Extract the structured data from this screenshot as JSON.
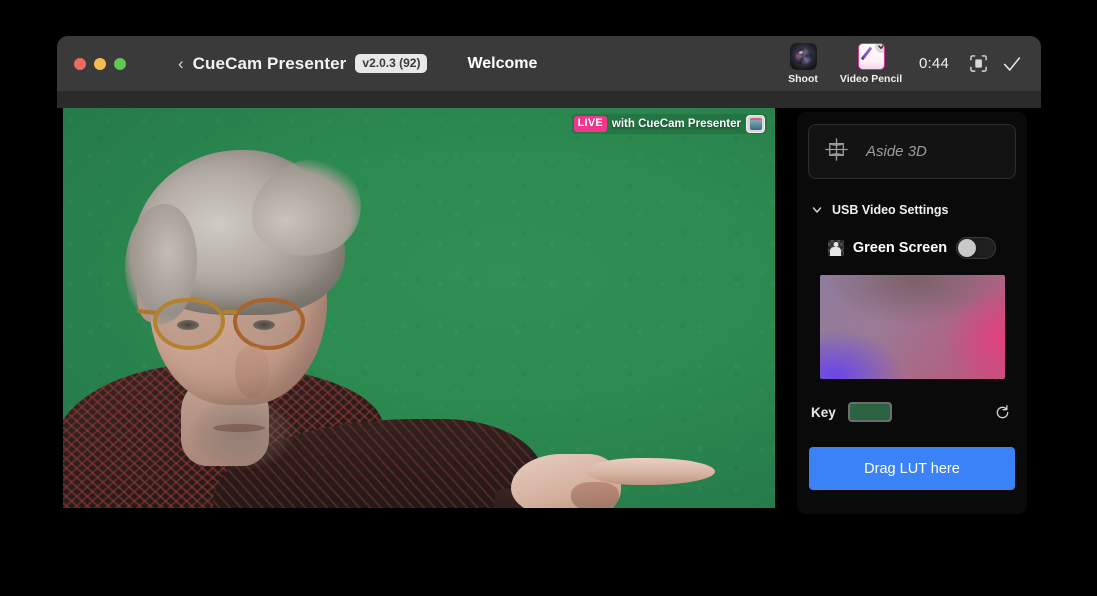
{
  "window": {
    "traffic_lights": [
      "close",
      "minimize",
      "zoom"
    ],
    "back_chevron": "‹",
    "app_name": "CueCam Presenter",
    "version": "v2.0.3 (92)",
    "document_title": "Welcome"
  },
  "toolbar": {
    "items": [
      {
        "label": "Shoot",
        "icon": "camera-lens-icon"
      },
      {
        "label": "Video Pencil",
        "icon": "video-pencil-icon",
        "badge": "checkmark"
      }
    ],
    "timer": "0:44",
    "scan_icon": "scan-frame-icon",
    "confirm_icon": "checkmark-icon"
  },
  "video": {
    "live_badge": "LIVE",
    "live_text": "with CueCam Presenter",
    "app_icon": "cuecam-app-icon",
    "background_color": "#2d8f52",
    "subject": "presenter-pointing"
  },
  "sidebar": {
    "aside": {
      "icon": "3d-plane-grid-icon",
      "placeholder": "Aside 3D"
    },
    "section": {
      "disclosure_icon": "chevron-down-icon",
      "title": "USB Video Settings"
    },
    "green_screen": {
      "icon": "portrait-matte-icon",
      "label": "Green Screen",
      "enabled": false
    },
    "gradient_preview": {
      "name": "chroma-gradient-preview",
      "colors": [
        "#6a45e8",
        "#e0407e",
        "#8f7c9e",
        "#c0527e"
      ]
    },
    "key": {
      "label": "Key",
      "color": "#2b6343",
      "reset_icon": "reset-arrow-icon"
    },
    "lut": {
      "label": "Drag LUT here",
      "color": "#3b82f6"
    }
  }
}
